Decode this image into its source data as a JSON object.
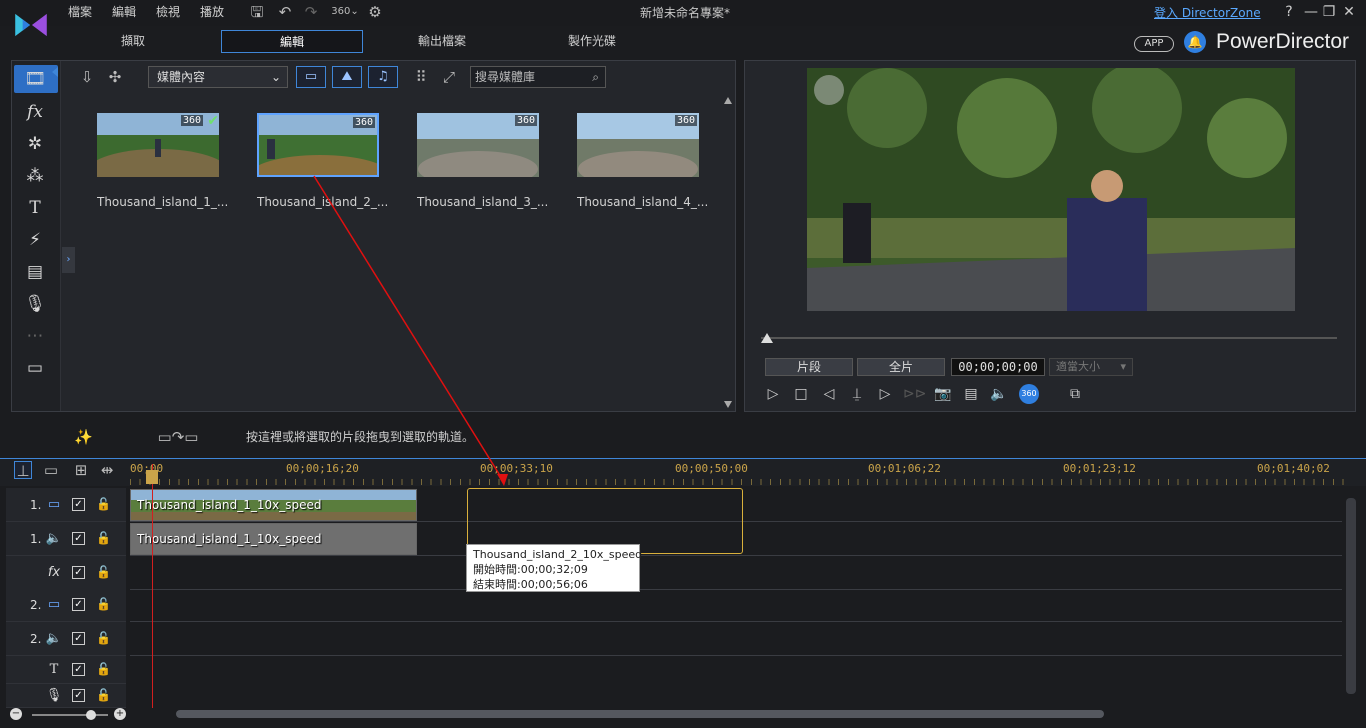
{
  "window": {
    "title": "新增未命名專案*",
    "signin": "登入 DirectorZone",
    "help": "?"
  },
  "menu": [
    "檔案",
    "編輯",
    "檢視",
    "播放"
  ],
  "tabs": [
    "擷取",
    "編輯",
    "輸出檔案",
    "製作光碟"
  ],
  "brand": {
    "app_label": "APP",
    "name": "PowerDirector",
    "accent": "#3f86d8"
  },
  "library": {
    "media_select": "媒體內容",
    "search_placeholder": "搜尋媒體庫",
    "items": [
      {
        "name": "Thousand_island_1_...",
        "badge": "360",
        "checked": true
      },
      {
        "name": "Thousand_island_2_...",
        "badge": "360",
        "selected": true
      },
      {
        "name": "Thousand_island_3_...",
        "badge": "360"
      },
      {
        "name": "Thousand_island_4_...",
        "badge": "360"
      }
    ]
  },
  "preview": {
    "clip_btn": "片段",
    "full_btn": "全片",
    "timecode": "00;00;00;00",
    "fit_select": "適當大小"
  },
  "timeline": {
    "hint": "按這裡或將選取的片段拖曳到選取的軌道。",
    "ruler": [
      "00;00",
      "00;00;16;20",
      "00;00;33;10",
      "00;00;50;00",
      "00;01;06;22",
      "00;01;23;12",
      "00;01;40;02"
    ],
    "tracks": [
      {
        "num": "1.",
        "icon": "video-track-icon"
      },
      {
        "num": "1.",
        "icon": "audio-track-icon"
      },
      {
        "num": "",
        "icon": "fx-track-icon",
        "label": "fx"
      },
      {
        "num": "2.",
        "icon": "video-track-icon"
      },
      {
        "num": "2.",
        "icon": "audio-track-icon"
      },
      {
        "num": "",
        "icon": "title-track-icon",
        "label": "T"
      },
      {
        "num": "",
        "icon": "voice-track-icon"
      }
    ],
    "video_clip": "Thousand_island_1_10x_speed",
    "audio_clip": "Thousand_island_1_10x_speed",
    "tooltip": {
      "name": "Thousand_island_2_10x_speed",
      "start": "開始時間:00;00;32;09",
      "end": "結束時間:00;00;56;06"
    }
  }
}
